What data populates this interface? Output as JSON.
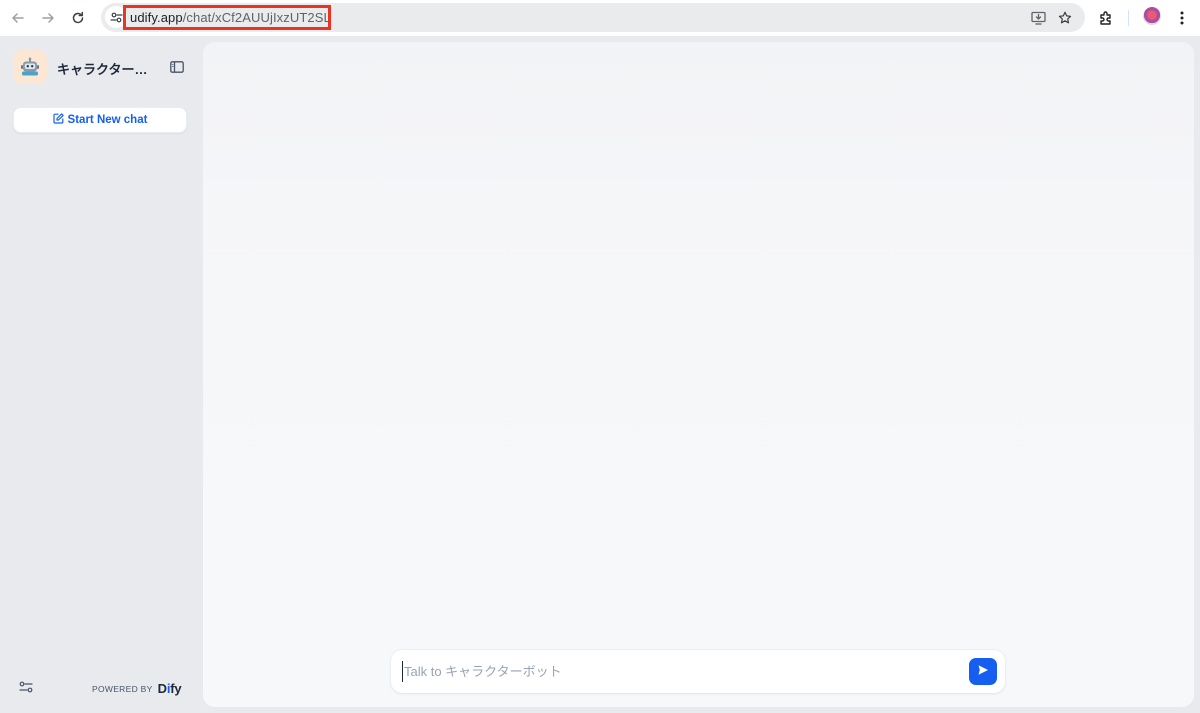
{
  "browser": {
    "url_host": "udify.app",
    "url_path": "/chat/xCf2AUUjIxzUT2SL",
    "icons": [
      "back-icon",
      "forward-icon",
      "reload-icon",
      "site-info-icon",
      "install-app-icon",
      "bookmark-star-icon",
      "extensions-icon",
      "profile-avatar",
      "chrome-menu-icon"
    ],
    "highlight_color": "#ea3323"
  },
  "sidebar": {
    "app_name": "キャラクターボ...",
    "new_chat_label": "Start New chat",
    "powered_by_label": "POWERED BY",
    "brand_prefix": "D",
    "brand_accent": "i",
    "brand_suffix": "fy"
  },
  "chat": {
    "input_placeholder": "Talk to キャラクターボット",
    "input_value": ""
  },
  "colors": {
    "accent": "#155eef",
    "sidebar_bg": "#e9eaee",
    "panel_bg": "#f6f7f9"
  }
}
